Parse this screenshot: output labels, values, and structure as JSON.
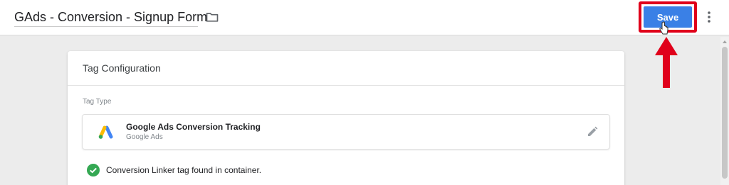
{
  "header": {
    "tag_title": "GAds - Conversion - Signup Form",
    "folder_icon": "folder-icon",
    "save_label": "Save",
    "more_icon": "more-vert-icon"
  },
  "annotation": {
    "highlight_color": "#e0001b",
    "arrow_icon": "up-arrow-icon"
  },
  "tag_configuration": {
    "title": "Tag Configuration",
    "tag_type_label": "Tag Type",
    "tag_type": {
      "name": "Google Ads Conversion Tracking",
      "provider": "Google Ads",
      "logo": "google-ads-logo",
      "edit_icon": "pencil-icon"
    },
    "linker_status": {
      "icon": "check-circle-icon",
      "text": "Conversion Linker tag found in container.",
      "color": "#34a853"
    }
  },
  "colors": {
    "primary": "#3a80e6",
    "page_background": "#ececec"
  }
}
